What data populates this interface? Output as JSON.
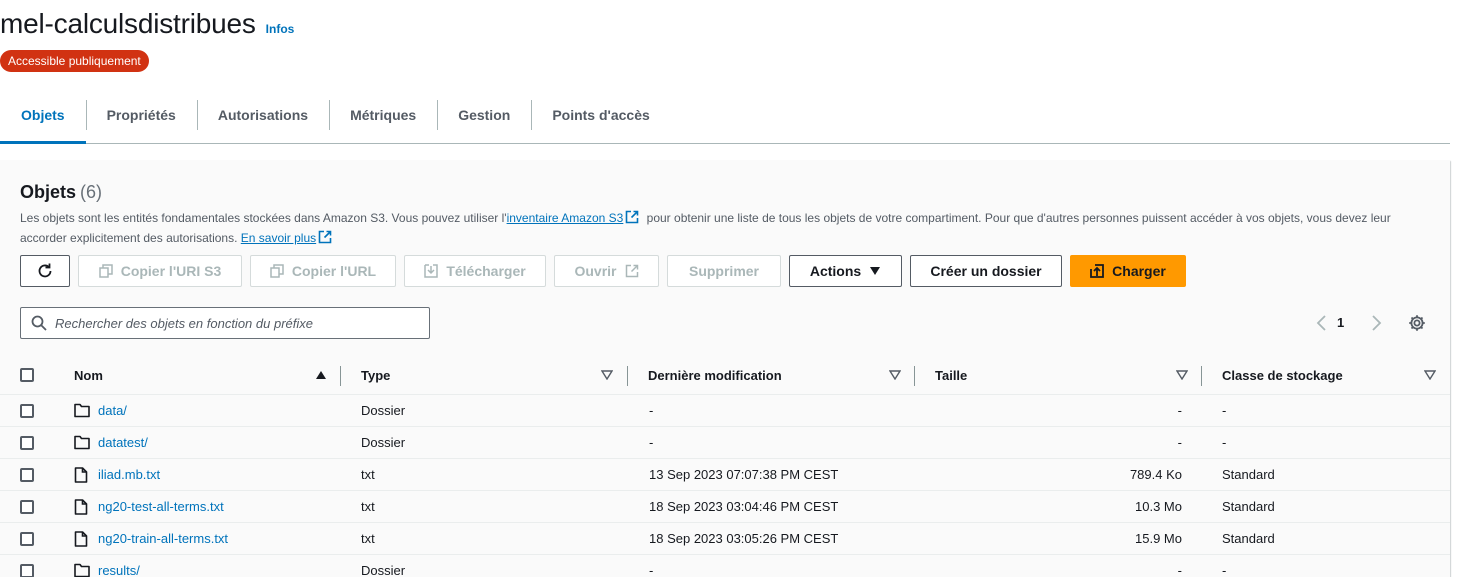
{
  "bucket": {
    "name": "mel-calculsdistribues",
    "info_link": "Infos",
    "access_badge": "Accessible publiquement"
  },
  "tabs": [
    {
      "label": "Objets",
      "active": true
    },
    {
      "label": "Propriétés",
      "active": false
    },
    {
      "label": "Autorisations",
      "active": false
    },
    {
      "label": "Métriques",
      "active": false
    },
    {
      "label": "Gestion",
      "active": false
    },
    {
      "label": "Points d'accès",
      "active": false
    }
  ],
  "objects_panel": {
    "title": "Objets",
    "count": "(6)",
    "description": {
      "part1": "Les objets sont les entités fondamentales stockées dans Amazon S3. Vous pouvez utiliser l'",
      "inventory_link": "inventaire Amazon S3",
      "part2": " pour obtenir une liste de tous les objets de votre compartiment. Pour que d'autres personnes puissent accéder à vos objets, vous devez leur accorder explicitement des autorisations. ",
      "learn_more_link": "En savoir plus"
    },
    "toolbar": {
      "copy_s3_uri": "Copier l'URI S3",
      "copy_url": "Copier l'URL",
      "download": "Télécharger",
      "open": "Ouvrir",
      "delete": "Supprimer",
      "actions": "Actions",
      "create_folder": "Créer un dossier",
      "upload": "Charger"
    },
    "search": {
      "placeholder": "Rechercher des objets en fonction du préfixe",
      "value": ""
    },
    "pagination": {
      "current_page": "1"
    },
    "columns": {
      "name": "Nom",
      "type": "Type",
      "last_modified": "Dernière modification",
      "size": "Taille",
      "storage_class": "Classe de stockage"
    },
    "rows": [
      {
        "name": "data/",
        "kind": "folder",
        "type": "Dossier",
        "last_modified": "-",
        "size": "-",
        "storage_class": "-"
      },
      {
        "name": "datatest/",
        "kind": "folder",
        "type": "Dossier",
        "last_modified": "-",
        "size": "-",
        "storage_class": "-"
      },
      {
        "name": "iliad.mb.txt",
        "kind": "file",
        "type": "txt",
        "last_modified": "13 Sep 2023 07:07:38 PM CEST",
        "size": "789.4 Ko",
        "storage_class": "Standard"
      },
      {
        "name": "ng20-test-all-terms.txt",
        "kind": "file",
        "type": "txt",
        "last_modified": "18 Sep 2023 03:04:46 PM CEST",
        "size": "10.3 Mo",
        "storage_class": "Standard"
      },
      {
        "name": "ng20-train-all-terms.txt",
        "kind": "file",
        "type": "txt",
        "last_modified": "18 Sep 2023 03:05:26 PM CEST",
        "size": "15.9 Mo",
        "storage_class": "Standard"
      },
      {
        "name": "results/",
        "kind": "folder",
        "type": "Dossier",
        "last_modified": "-",
        "size": "-",
        "storage_class": "-"
      }
    ]
  },
  "colors": {
    "link": "#0073bb",
    "badge": "#d13212",
    "primary_button": "#ff9900",
    "text": "#16191f"
  },
  "icons": {
    "refresh": "refresh-icon",
    "copy": "copy-icon",
    "download": "download-icon",
    "external": "external-link-icon",
    "upload": "upload-icon",
    "caret": "caret-down-icon",
    "search": "search-icon",
    "settings": "gear-icon",
    "folder": "folder-icon",
    "file": "file-icon"
  }
}
